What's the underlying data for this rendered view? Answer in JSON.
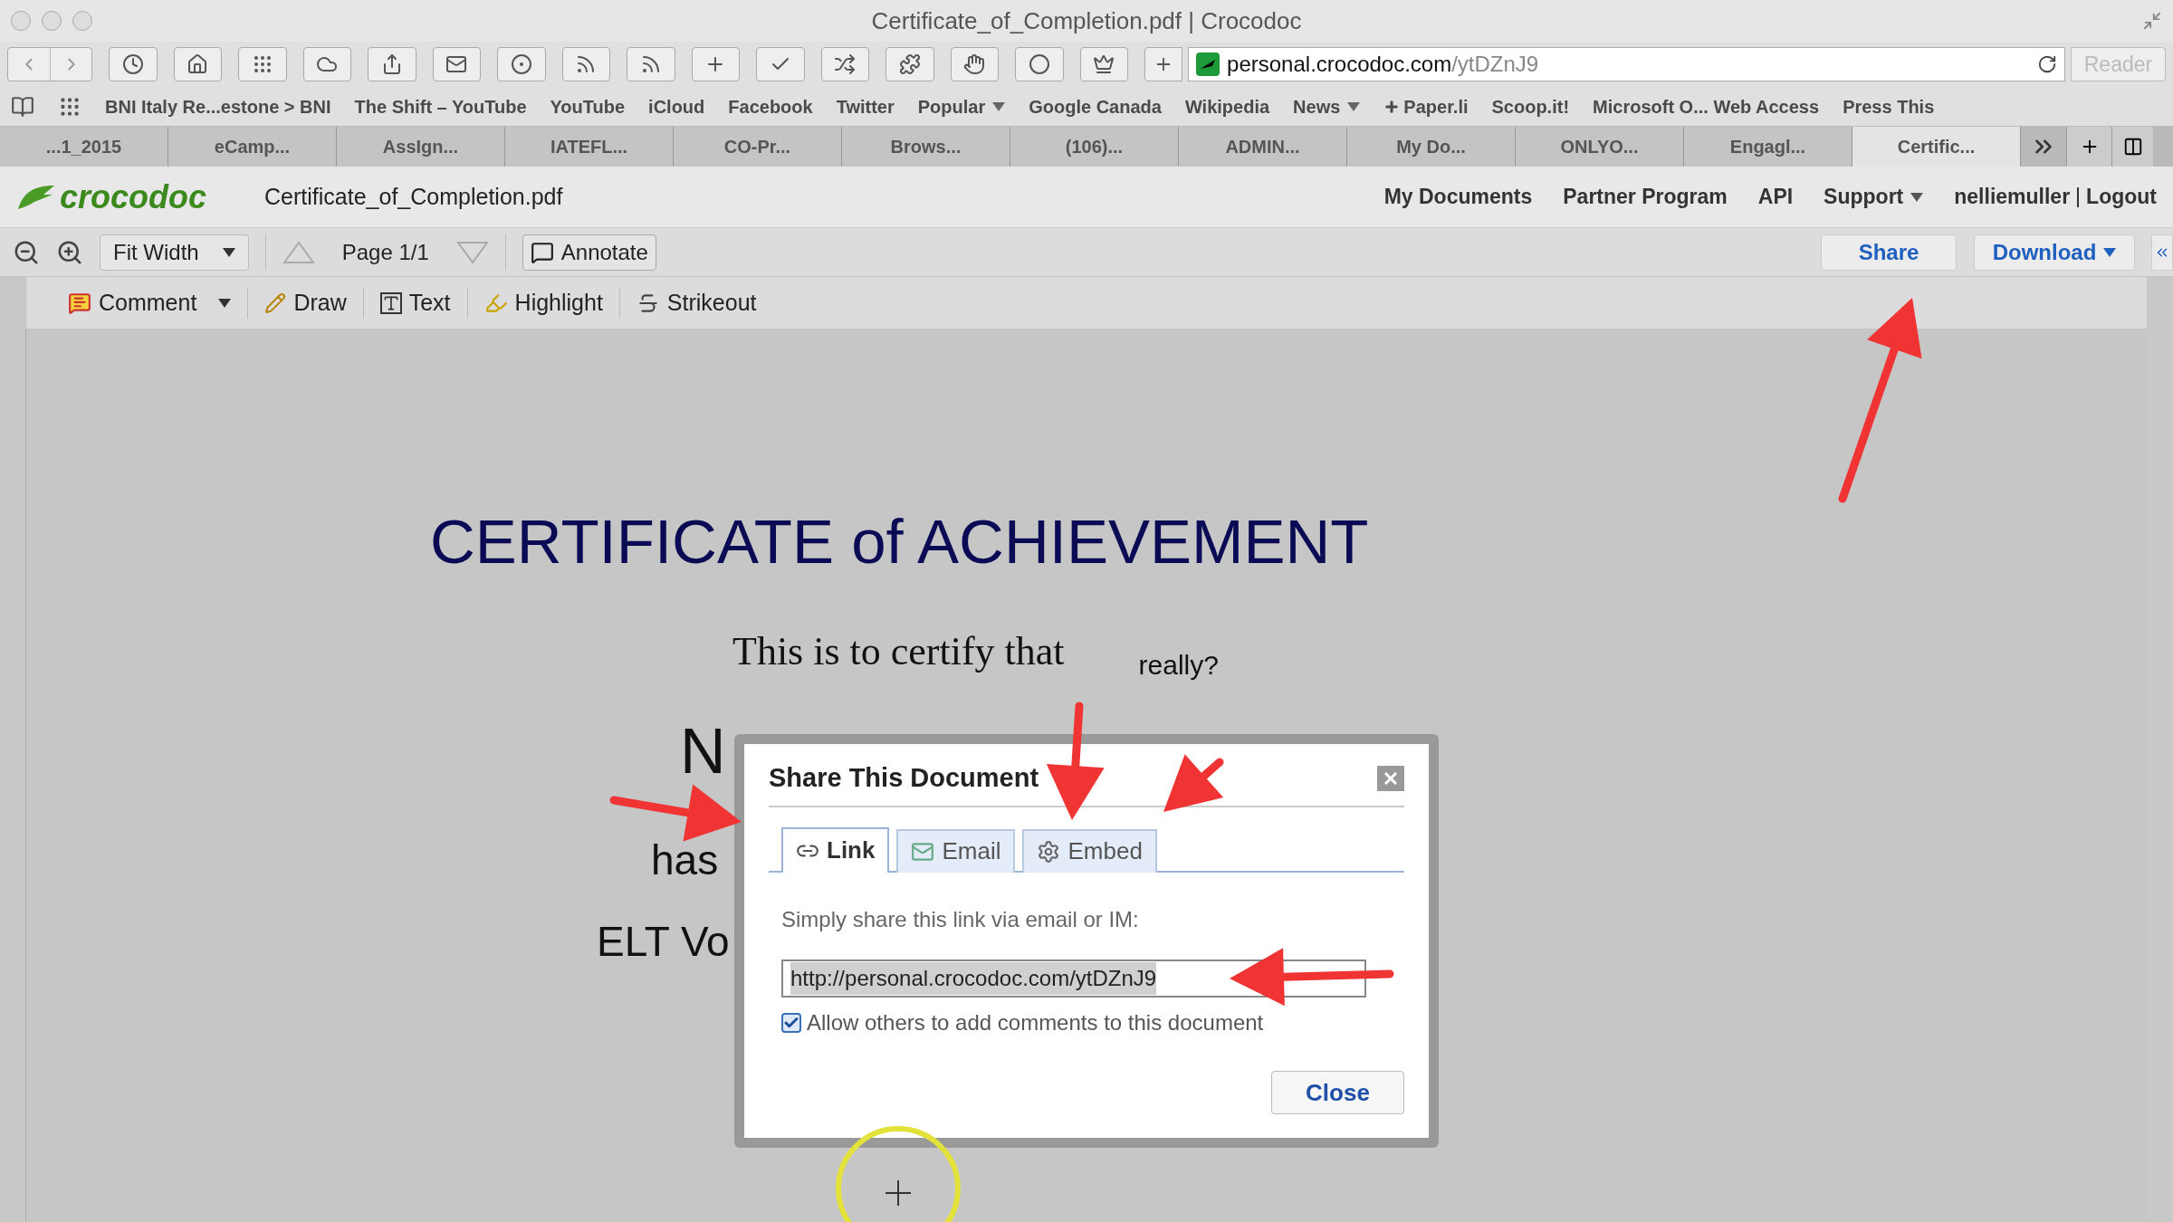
{
  "window": {
    "title": "Certificate_of_Completion.pdf | Crocodoc"
  },
  "address_bar": {
    "host": "personal.crocodoc.com",
    "path": "/ytDZnJ9"
  },
  "reader_button": {
    "label": "Reader",
    "disabled": true
  },
  "bookmarks": [
    {
      "label": "BNI Italy Re...estone > BNI",
      "kind": "plain",
      "menu": false
    },
    {
      "label": "The Shift – YouTube",
      "kind": "plain",
      "menu": false
    },
    {
      "label": "YouTube",
      "kind": "plain",
      "menu": false
    },
    {
      "label": "iCloud",
      "kind": "plain",
      "menu": false
    },
    {
      "label": "Facebook",
      "kind": "plain",
      "menu": false
    },
    {
      "label": "Twitter",
      "kind": "plain",
      "menu": false
    },
    {
      "label": "Popular",
      "kind": "plain",
      "menu": true
    },
    {
      "label": "Google Canada",
      "kind": "plain",
      "menu": false
    },
    {
      "label": "Wikipedia",
      "kind": "plain",
      "menu": false
    },
    {
      "label": "News",
      "kind": "plain",
      "menu": true
    },
    {
      "label": "Paper.li",
      "kind": "plus",
      "menu": false
    },
    {
      "label": "Scoop.it!",
      "kind": "plain",
      "menu": false
    },
    {
      "label": "Microsoft O... Web Access",
      "kind": "plain",
      "menu": false
    },
    {
      "label": "Press This",
      "kind": "plain",
      "menu": false
    }
  ],
  "tabs": [
    {
      "label": "...1_2015",
      "selected": false
    },
    {
      "label": "eCamp...",
      "selected": false
    },
    {
      "label": "AssIgn...",
      "selected": false
    },
    {
      "label": "IATEFL...",
      "selected": false
    },
    {
      "label": "CO-Pr...",
      "selected": false
    },
    {
      "label": "Brows...",
      "selected": false
    },
    {
      "label": "(106)...",
      "selected": false
    },
    {
      "label": "ADMIN...",
      "selected": false
    },
    {
      "label": "My Do...",
      "selected": false
    },
    {
      "label": "ONLYO...",
      "selected": false
    },
    {
      "label": "Engagl...",
      "selected": false
    },
    {
      "label": "Certific...",
      "selected": true
    }
  ],
  "app": {
    "logo": "crocodoc",
    "file_name": "Certificate_of_Completion.pdf",
    "nav": [
      {
        "label": "My Documents",
        "menu": false
      },
      {
        "label": "Partner Program",
        "menu": false
      },
      {
        "label": "API",
        "menu": false
      },
      {
        "label": "Support",
        "menu": true
      }
    ],
    "user": "nelliemuller",
    "logout": "Logout"
  },
  "viewer_toolbar": {
    "zoom": "Fit Width",
    "page": "Page 1/1",
    "annotate": "Annotate",
    "share": "Share",
    "download": "Download"
  },
  "annotation_tools": [
    {
      "label": "Comment",
      "kind": "comment",
      "menu": true
    },
    {
      "label": "Draw",
      "kind": "draw",
      "menu": false
    },
    {
      "label": "Text",
      "kind": "text",
      "menu": false
    },
    {
      "label": "Highlight",
      "kind": "highlight",
      "menu": false
    },
    {
      "label": "Strikeout",
      "kind": "strikeout",
      "menu": false
    }
  ],
  "document": {
    "title": "CERTIFICATE of ACHIEVEMENT",
    "certify": "This is to certify that",
    "note": "really?",
    "name_fragment": "N",
    "line_fragment": "has",
    "org_fragment": "ELT Vo"
  },
  "dialog": {
    "title": "Share This Document",
    "tabs": [
      {
        "label": "Link",
        "kind": "link",
        "selected": true
      },
      {
        "label": "Email",
        "kind": "email",
        "selected": false
      },
      {
        "label": "Embed",
        "kind": "embed",
        "selected": false
      }
    ],
    "instructions": "Simply share this link via email or IM:",
    "link": "http://personal.crocodoc.com/ytDZnJ9",
    "allow_comments": {
      "label": "Allow others to add comments to this document",
      "checked": true
    },
    "close": "Close"
  }
}
